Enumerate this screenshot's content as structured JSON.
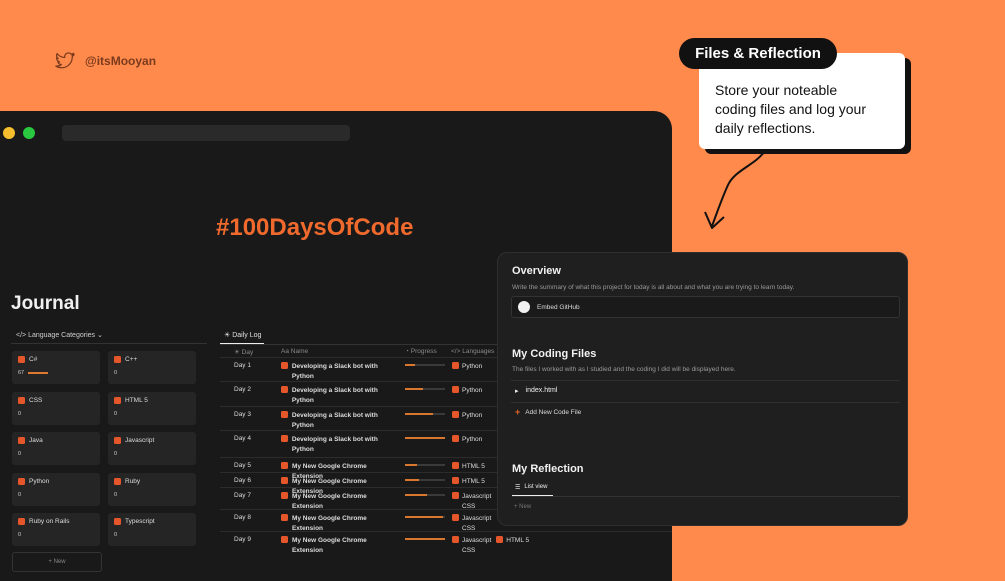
{
  "handle": {
    "name": "@itsMooyan",
    "icon": "twitter-bird-icon"
  },
  "callout": {
    "title": "Files & Reflection",
    "lines": [
      "Store your noteable",
      "coding files and log your",
      "daily reflections."
    ]
  },
  "window": {
    "hashtag": "#100DaysOfCode",
    "title": "Journal",
    "language_tab": "Language Categories",
    "categories": [
      {
        "name": "C#",
        "count": "67",
        "progress": 0.9
      },
      {
        "name": "C++",
        "count": "0",
        "progress": 0
      },
      {
        "name": "CSS",
        "count": "0",
        "progress": 0
      },
      {
        "name": "HTML 5",
        "count": "0",
        "progress": 0
      },
      {
        "name": "Java",
        "count": "0",
        "progress": 0
      },
      {
        "name": "Javascript",
        "count": "0",
        "progress": 0
      },
      {
        "name": "Python",
        "count": "0",
        "progress": 0
      },
      {
        "name": "Ruby",
        "count": "0",
        "progress": 0
      },
      {
        "name": "Ruby on Rails",
        "count": "0",
        "progress": 0
      },
      {
        "name": "Typescript",
        "count": "0",
        "progress": 0
      }
    ],
    "new_label": "+ New",
    "daily_log_tab": "Daily Log",
    "columns": {
      "day": "Day",
      "name": "Aa Name",
      "progress": "Progress",
      "languages": "Languages"
    },
    "rows": [
      {
        "day": "Day 1",
        "name": "Developing a Slack bot with Python",
        "progress": 0.25,
        "langs": [
          "Python"
        ]
      },
      {
        "day": "Day 2",
        "name": "Developing a Slack bot with Python",
        "progress": 0.45,
        "langs": [
          "Python"
        ]
      },
      {
        "day": "Day 3",
        "name": "Developing a Slack bot with Python",
        "progress": 0.7,
        "langs": [
          "Python"
        ]
      },
      {
        "day": "Day 4",
        "name": "Developing a Slack bot with Python",
        "progress": 1.0,
        "langs": [
          "Python"
        ]
      },
      {
        "day": "Day 5",
        "name": "My New Google Chrome Extension",
        "progress": 0.3,
        "langs": [
          "HTML 5"
        ]
      },
      {
        "day": "Day 6",
        "name": "My New Google Chrome Extension",
        "progress": 0.35,
        "langs": [
          "HTML 5"
        ]
      },
      {
        "day": "Day 7",
        "name": "My New Google Chrome Extension",
        "progress": 0.55,
        "langs": [
          "Javascript",
          "CSS"
        ]
      },
      {
        "day": "Day 8",
        "name": "My New Google Chrome Extension",
        "progress": 0.95,
        "langs": [
          "Javascript",
          "CSS"
        ]
      },
      {
        "day": "Day 9",
        "name": "My New Google Chrome Extension",
        "progress": 1.0,
        "langs": [
          "Javascript",
          "CSS"
        ],
        "extra": "HTML 5"
      }
    ]
  },
  "panel": {
    "overview_title": "Overview",
    "overview_desc": "Write the summary of what this project for today is all about and what you are trying to learn today.",
    "embed_label": "Embed GitHub",
    "files_title": "My Coding Files",
    "files_desc": "The files I worked with as I studied and the coding I did will be displayed here.",
    "file_name": "index.html",
    "add_file_label": "Add New Code File",
    "reflection_title": "My Reflection",
    "list_view_label": "List view",
    "new_label": "+ New"
  },
  "colors": {
    "background": "#FF8A4C",
    "accent": "#F06A2E",
    "window": "#191919"
  }
}
